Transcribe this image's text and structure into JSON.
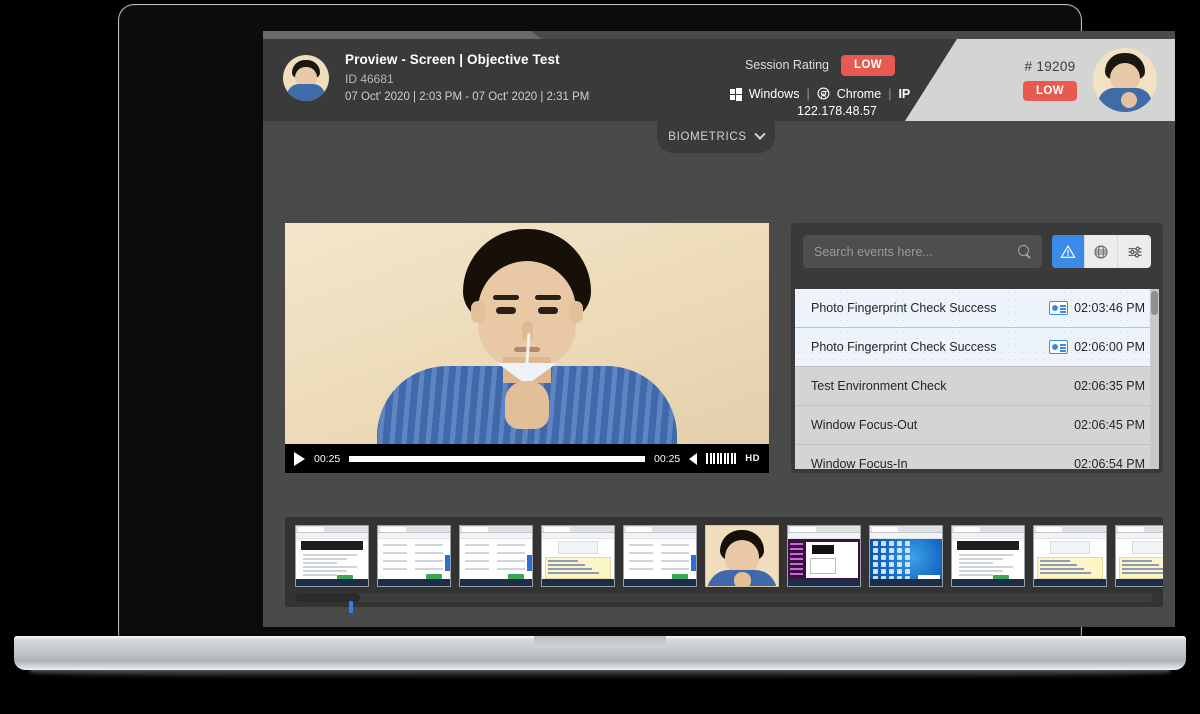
{
  "header": {
    "title": "Proview - Screen | Objective Test",
    "id_label": "ID 46681",
    "date_range": "07 Oct' 2020 | 2:03 PM - 07 Oct' 2020 | 2:31 PM",
    "session_rating_label": "Session Rating",
    "session_rating_value": "LOW",
    "os_label": "Windows",
    "browser_label": "Chrome",
    "ip_label": "IP",
    "ip_value": "122.178.48.57",
    "separator": "|",
    "candidate_id": "# 19209",
    "candidate_rating": "LOW",
    "accent_red": "#e8594f",
    "accent_blue": "#3b8ae8"
  },
  "biometrics_tab": {
    "label": "BIOMETRICS"
  },
  "video": {
    "current_time": "00:25",
    "total_time": "00:25",
    "quality_label": "HD",
    "progress_percent": 100
  },
  "events_panel": {
    "search_placeholder": "Search events here...",
    "search_value": "",
    "toolbar": [
      {
        "name": "alerts-filter",
        "icon": "warning-triangle-icon",
        "active": true
      },
      {
        "name": "web-filter",
        "icon": "globe-icon",
        "active": false
      },
      {
        "name": "settings-filter",
        "icon": "sliders-icon",
        "active": false
      }
    ],
    "rows": [
      {
        "name": "Photo Fingerprint Check Success",
        "time": "02:03:46 PM",
        "badge": "id-card-icon",
        "highlight": true
      },
      {
        "name": "Photo Fingerprint Check Success",
        "time": "02:06:00 PM",
        "badge": "id-card-icon",
        "highlight": true
      },
      {
        "name": "Test Environment Check",
        "time": "02:06:35 PM",
        "badge": null,
        "highlight": false
      },
      {
        "name": "Window Focus-Out",
        "time": "02:06:45 PM",
        "badge": null,
        "highlight": false
      },
      {
        "name": "Window Focus-In",
        "time": "02:06:54 PM",
        "badge": null,
        "highlight": false
      }
    ]
  },
  "filmstrip": {
    "thumbnails": [
      {
        "kind": "browser-doc"
      },
      {
        "kind": "browser-form"
      },
      {
        "kind": "browser-list"
      },
      {
        "kind": "browser-yellow"
      },
      {
        "kind": "browser-list"
      },
      {
        "kind": "webcam"
      },
      {
        "kind": "browser-dark"
      },
      {
        "kind": "desktop"
      },
      {
        "kind": "browser-doc"
      },
      {
        "kind": "browser-yellow"
      },
      {
        "kind": "browser-yellow"
      },
      {
        "kind": "browser-table"
      }
    ]
  }
}
